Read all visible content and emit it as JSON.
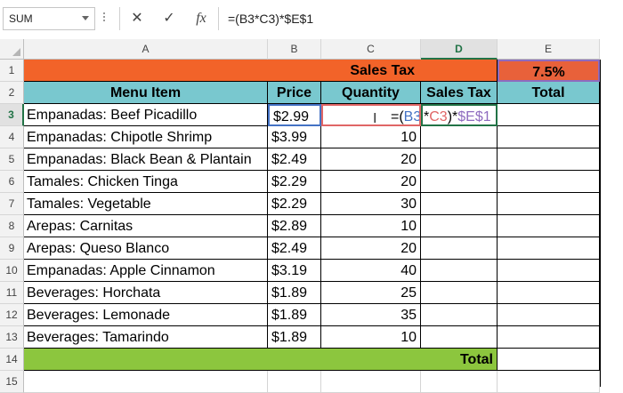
{
  "formula_bar": {
    "name_box": "SUM",
    "cancel_icon": "✕",
    "enter_icon": "✓",
    "fx_icon": "fx",
    "formula": "=(B3*C3)*$E$1"
  },
  "columns": [
    "A",
    "B",
    "C",
    "D",
    "E"
  ],
  "rows": [
    "1",
    "2",
    "3",
    "4",
    "5",
    "6",
    "7",
    "8",
    "9",
    "10",
    "11",
    "12",
    "13",
    "14",
    "15"
  ],
  "title_row": {
    "label": "Sales Tax",
    "rate": "7.5%"
  },
  "headers": {
    "item": "Menu Item",
    "price": "Price",
    "quantity": "Quantity",
    "tax": "Sales Tax",
    "total": "Total"
  },
  "items": [
    {
      "name": "Empanadas: Beef Picadillo",
      "price": "$2.99",
      "qty": ""
    },
    {
      "name": "Empanadas: Chipotle Shrimp",
      "price": "$3.99",
      "qty": "10"
    },
    {
      "name": "Empanadas:  Black Bean & Plantain",
      "price": "$2.49",
      "qty": "20"
    },
    {
      "name": "Tamales: Chicken Tinga",
      "price": "$2.29",
      "qty": "20"
    },
    {
      "name": "Tamales: Vegetable",
      "price": "$2.29",
      "qty": "30"
    },
    {
      "name": "Arepas: Carnitas",
      "price": "$2.89",
      "qty": "10"
    },
    {
      "name": "Arepas: Queso Blanco",
      "price": "$2.49",
      "qty": "20"
    },
    {
      "name": "Empanadas: Apple Cinnamon",
      "price": "$3.19",
      "qty": "40"
    },
    {
      "name": "Beverages: Horchata",
      "price": "$1.89",
      "qty": "25"
    },
    {
      "name": "Beverages: Lemonade",
      "price": "$1.89",
      "qty": "35"
    },
    {
      "name": "Beverages: Tamarindo",
      "price": "$1.89",
      "qty": "10"
    }
  ],
  "editing_formula": {
    "open": "=(",
    "ref1": "B3",
    "op": "*",
    "ref2": "C3",
    "close": ")*",
    "ref3": "$E$1"
  },
  "total_label": "Total",
  "colors": {
    "orange": "#f26329",
    "teal": "#79c8cf",
    "green": "#8cc63e",
    "excel_green": "#217346",
    "ref_blue": "#4472c4",
    "ref_red": "#e06666",
    "ref_purple": "#8e6bbf"
  }
}
